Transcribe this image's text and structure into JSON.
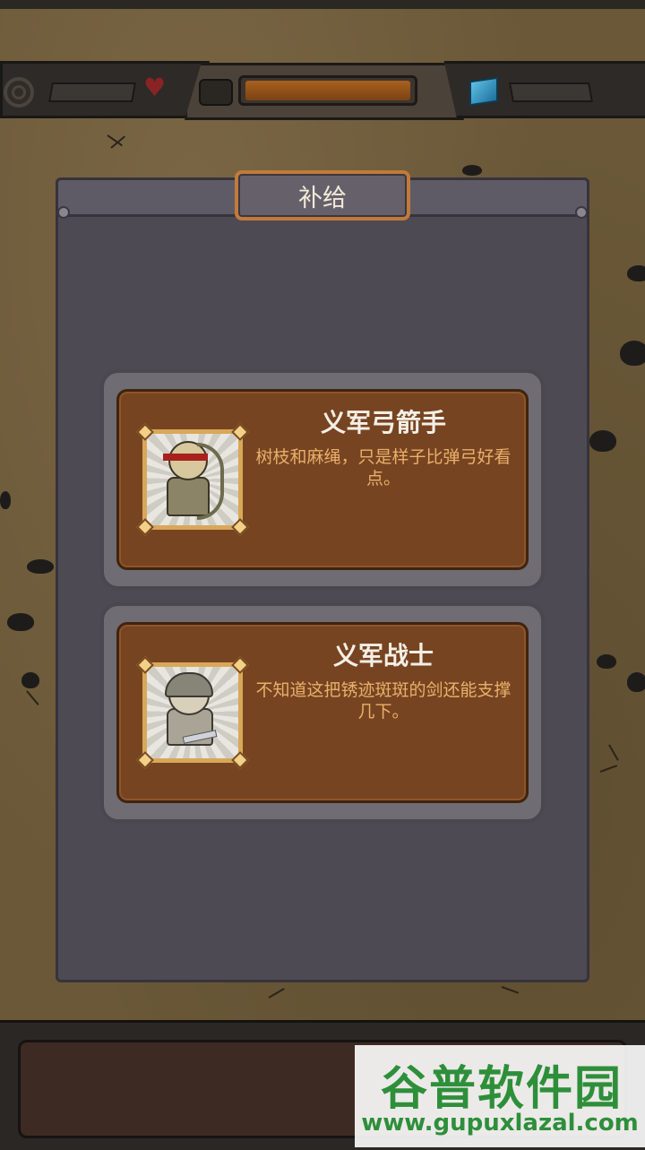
{
  "hud": {
    "gold_progress": 0.92,
    "icons": [
      "gear-icon",
      "heart-icon",
      "gem-icon"
    ]
  },
  "panel": {
    "title": "补给",
    "units": [
      {
        "name": "义军弓箭手",
        "description": "树枝和麻绳，只是样子比弹弓好看点。",
        "portrait_icon": "archer-portrait"
      },
      {
        "name": "义军战士",
        "description": "不知道这把锈迹斑斑的剑还能支撑几下。",
        "portrait_icon": "warrior-portrait"
      }
    ]
  },
  "watermark": {
    "title": "谷普软件园",
    "url": "www.gupuxlazal.com"
  },
  "colors": {
    "panel": "#4d4a54",
    "card": "#774421",
    "title_text": "#f4efe6",
    "desc_text": "#e9b06b",
    "tab_border": "#c27a3a"
  }
}
